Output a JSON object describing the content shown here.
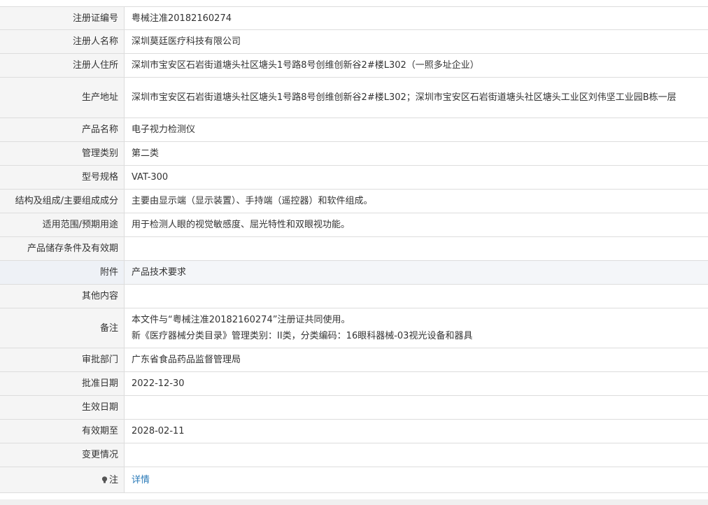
{
  "rows": [
    {
      "label": "注册证编号",
      "value": "粤械注准20182160274"
    },
    {
      "label": "注册人名称",
      "value": "深圳莫廷医疗科技有限公司"
    },
    {
      "label": "注册人住所",
      "value": "深圳市宝安区石岩街道塘头社区塘头1号路8号创维创新谷2#楼L302（一照多址企业）"
    },
    {
      "label": "生产地址",
      "value": "深圳市宝安区石岩街道塘头社区塘头1号路8号创维创新谷2#楼L302；深圳市宝安区石岩街道塘头社区塘头工业区刘伟坚工业园B栋一层"
    },
    {
      "label": "产品名称",
      "value": "电子视力检测仪"
    },
    {
      "label": "管理类别",
      "value": "第二类"
    },
    {
      "label": "型号规格",
      "value": "VAT-300"
    },
    {
      "label": "结构及组成/主要组成成分",
      "value": "主要由显示端（显示装置）、手持端（遥控器）和软件组成。"
    },
    {
      "label": "适用范围/预期用途",
      "value": "用于检测人眼的视觉敏感度、屈光特性和双眼视功能。"
    },
    {
      "label": "产品储存条件及有效期",
      "value": ""
    },
    {
      "label": "附件",
      "value": "产品技术要求"
    },
    {
      "label": "其他内容",
      "value": ""
    },
    {
      "label": "备注",
      "value_lines": [
        "本文件与“粤械注准20182160274”注册证共同使用。",
        "新《医疗器械分类目录》管理类别：II类，分类编码：16眼科器械-03视光设备和器具"
      ]
    },
    {
      "label": "审批部门",
      "value": "广东省食品药品监督管理局"
    },
    {
      "label": "批准日期",
      "value": "2022-12-30"
    },
    {
      "label": "生效日期",
      "value": ""
    },
    {
      "label": "有效期至",
      "value": "2028-02-11"
    },
    {
      "label": "变更情况",
      "value": ""
    }
  ],
  "note": {
    "icon": "lightbulb-icon",
    "label": "注",
    "link_text": "详情"
  },
  "colors": {
    "label_bg": "#f5f5f5",
    "highlight_bg": "#f4f6f9",
    "border": "#dddddd",
    "link": "#2a7ab8"
  }
}
